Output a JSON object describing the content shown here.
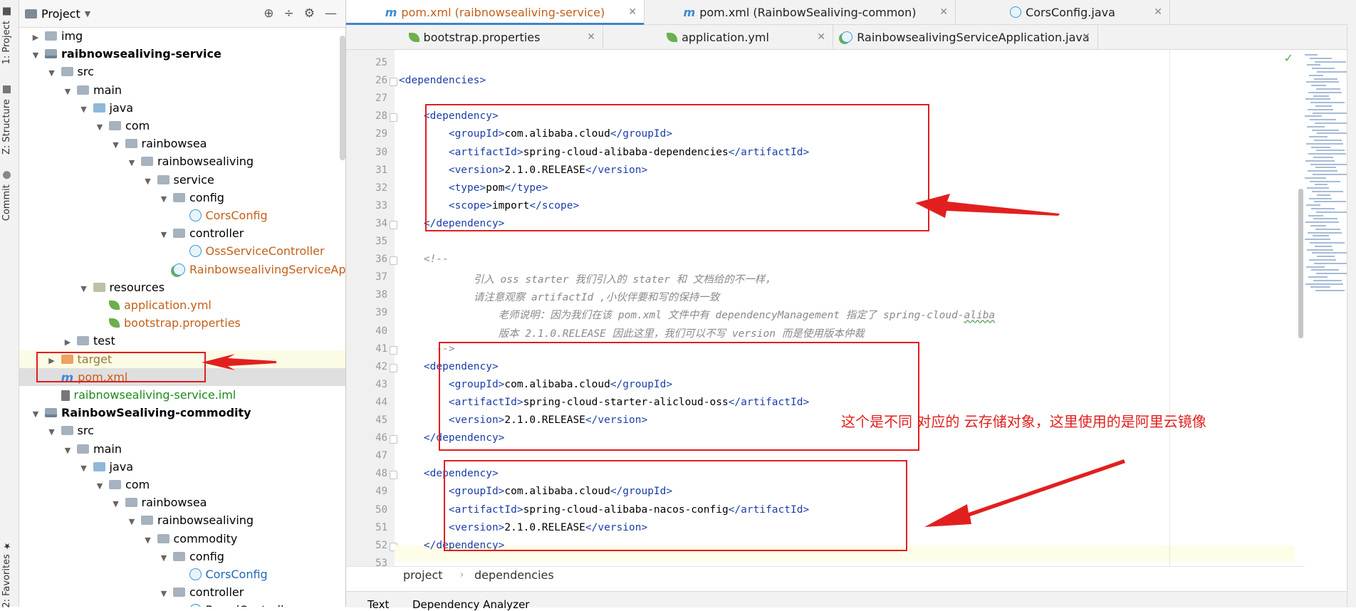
{
  "tool_strip": {
    "tabs": [
      "1: Project",
      "Z: Structure",
      "Commit",
      "2: Favorites"
    ]
  },
  "project_panel": {
    "title": "Project",
    "tree": [
      {
        "label": "img",
        "depth": 1,
        "arrow": "collapsed",
        "icon": "folder",
        "style": ""
      },
      {
        "label": "raibnowsealiving-service",
        "depth": 1,
        "arrow": "expanded",
        "icon": "module-folder",
        "style": "bold"
      },
      {
        "label": "src",
        "depth": 2,
        "arrow": "expanded",
        "icon": "folder",
        "style": ""
      },
      {
        "label": "main",
        "depth": 3,
        "arrow": "expanded",
        "icon": "folder",
        "style": ""
      },
      {
        "label": "java",
        "depth": 4,
        "arrow": "expanded",
        "icon": "source-folder",
        "style": ""
      },
      {
        "label": "com",
        "depth": 5,
        "arrow": "expanded",
        "icon": "package",
        "style": ""
      },
      {
        "label": "rainbowsea",
        "depth": 6,
        "arrow": "expanded",
        "icon": "package",
        "style": ""
      },
      {
        "label": "rainbowsealiving",
        "depth": 7,
        "arrow": "expanded",
        "icon": "package",
        "style": ""
      },
      {
        "label": "service",
        "depth": 8,
        "arrow": "expanded",
        "icon": "package",
        "style": ""
      },
      {
        "label": "config",
        "depth": 9,
        "arrow": "expanded",
        "icon": "package",
        "style": ""
      },
      {
        "label": "CorsConfig",
        "depth": 10,
        "arrow": "none",
        "icon": "class",
        "style": "orange"
      },
      {
        "label": "controller",
        "depth": 9,
        "arrow": "expanded",
        "icon": "package",
        "style": ""
      },
      {
        "label": "OssServiceController",
        "depth": 10,
        "arrow": "none",
        "icon": "class",
        "style": "orange"
      },
      {
        "label": "RainbowsealivingServiceApp",
        "depth": 9,
        "arrow": "none",
        "icon": "spring-class",
        "style": "orange"
      },
      {
        "label": "resources",
        "depth": 4,
        "arrow": "expanded",
        "icon": "resources-folder",
        "style": ""
      },
      {
        "label": "application.yml",
        "depth": 5,
        "arrow": "none",
        "icon": "leaf",
        "style": "orange"
      },
      {
        "label": "bootstrap.properties",
        "depth": 5,
        "arrow": "none",
        "icon": "leaf",
        "style": "orange"
      },
      {
        "label": "test",
        "depth": 3,
        "arrow": "collapsed",
        "icon": "folder",
        "style": ""
      },
      {
        "label": "target",
        "depth": 2,
        "arrow": "collapsed",
        "icon": "target-folder",
        "style": "olive",
        "row": "highlight"
      },
      {
        "label": "pom.xml",
        "depth": 2,
        "arrow": "none",
        "icon": "maven",
        "style": "orange",
        "row": "selected"
      },
      {
        "label": "raibnowsealiving-service.iml",
        "depth": 2,
        "arrow": "none",
        "icon": "iml",
        "style": "green"
      },
      {
        "label": "RainbowSealiving-commodity",
        "depth": 1,
        "arrow": "expanded",
        "icon": "module-folder",
        "style": "bold"
      },
      {
        "label": "src",
        "depth": 2,
        "arrow": "expanded",
        "icon": "folder",
        "style": ""
      },
      {
        "label": "main",
        "depth": 3,
        "arrow": "expanded",
        "icon": "folder",
        "style": ""
      },
      {
        "label": "java",
        "depth": 4,
        "arrow": "expanded",
        "icon": "source-folder",
        "style": ""
      },
      {
        "label": "com",
        "depth": 5,
        "arrow": "expanded",
        "icon": "package",
        "style": ""
      },
      {
        "label": "rainbowsea",
        "depth": 6,
        "arrow": "expanded",
        "icon": "package",
        "style": ""
      },
      {
        "label": "rainbowsealiving",
        "depth": 7,
        "arrow": "expanded",
        "icon": "package",
        "style": ""
      },
      {
        "label": "commodity",
        "depth": 8,
        "arrow": "expanded",
        "icon": "package",
        "style": ""
      },
      {
        "label": "config",
        "depth": 9,
        "arrow": "expanded",
        "icon": "package",
        "style": ""
      },
      {
        "label": "CorsConfig",
        "depth": 10,
        "arrow": "none",
        "icon": "class",
        "style": "blue"
      },
      {
        "label": "controller",
        "depth": 9,
        "arrow": "expanded",
        "icon": "package",
        "style": ""
      },
      {
        "label": "BrandController",
        "depth": 10,
        "arrow": "none",
        "icon": "class",
        "style": ""
      }
    ]
  },
  "editor": {
    "tabs_row1": [
      {
        "label": "pom.xml (raibnowsealiving-service)",
        "icon": "maven",
        "active": true
      },
      {
        "label": "pom.xml (RainbowSealiving-common)",
        "icon": "maven",
        "active": false
      },
      {
        "label": "CorsConfig.java",
        "icon": "class",
        "active": false
      }
    ],
    "tabs_row2": [
      {
        "label": "bootstrap.properties",
        "icon": "leaf"
      },
      {
        "label": "application.yml",
        "icon": "leaf"
      },
      {
        "label": "RainbowsealivingServiceApplication.java",
        "icon": "spring-class"
      }
    ],
    "lines": [
      {
        "n": "25",
        "text": ""
      },
      {
        "n": "26",
        "text": "<dependencies>"
      },
      {
        "n": "27",
        "text": ""
      },
      {
        "n": "28",
        "text": "    <dependency>"
      },
      {
        "n": "29",
        "text": "        <groupId>com.alibaba.cloud</groupId>"
      },
      {
        "n": "30",
        "text": "        <artifactId>spring-cloud-alibaba-dependencies</artifactId>"
      },
      {
        "n": "31",
        "text": "        <version>2.1.0.RELEASE</version>"
      },
      {
        "n": "32",
        "text": "        <type>pom</type>"
      },
      {
        "n": "33",
        "text": "        <scope>import</scope>"
      },
      {
        "n": "34",
        "text": "    </dependency>"
      },
      {
        "n": "35",
        "text": ""
      },
      {
        "n": "36",
        "text": "    <!--",
        "comment": true
      },
      {
        "n": "37",
        "text": "            引入 oss starter 我们引入的 stater 和 文档给的不一样，",
        "comment": true
      },
      {
        "n": "38",
        "text": "            请注意观察 artifactId ,小伙伴要和写的保持一致",
        "comment": true
      },
      {
        "n": "39",
        "text": "                老师说明：因为我们在该 pom.xml 文件中有 dependencyManagement 指定了 spring-cloud-aliba",
        "comment": true
      },
      {
        "n": "40",
        "text": "                版本 2.1.0.RELEASE 因此这里，我们可以不写 version 而是使用版本仲裁",
        "comment": true
      },
      {
        "n": "41",
        "text": "      -->",
        "comment": true
      },
      {
        "n": "42",
        "text": "    <dependency>"
      },
      {
        "n": "43",
        "text": "        <groupId>com.alibaba.cloud</groupId>"
      },
      {
        "n": "44",
        "text": "        <artifactId>spring-cloud-starter-alicloud-oss</artifactId>"
      },
      {
        "n": "45",
        "text": "        <version>2.1.0.RELEASE</version>"
      },
      {
        "n": "46",
        "text": "    </dependency>"
      },
      {
        "n": "47",
        "text": ""
      },
      {
        "n": "48",
        "text": "    <dependency>"
      },
      {
        "n": "49",
        "text": "        <groupId>com.alibaba.cloud</groupId>"
      },
      {
        "n": "50",
        "text": "        <artifactId>spring-cloud-alibaba-nacos-config</artifactId>"
      },
      {
        "n": "51",
        "text": "        <version>2.1.0.RELEASE</version>"
      },
      {
        "n": "52",
        "text": "    </dependency>"
      },
      {
        "n": "53",
        "text": ""
      }
    ],
    "breadcrumb": [
      "project",
      "dependencies"
    ],
    "bottom_tabs": [
      "Text",
      "Dependency Analyzer"
    ]
  },
  "annotation": {
    "text": "这个是不同 对应的 云存储对象，这里使用的是阿里云镜像",
    "color": "#e21f1f"
  },
  "colors": {
    "tag": "#1b3ea8",
    "comment": "#8a8a8a",
    "orange_file": "#c45f1a",
    "accent_tab": "#4083c9"
  }
}
